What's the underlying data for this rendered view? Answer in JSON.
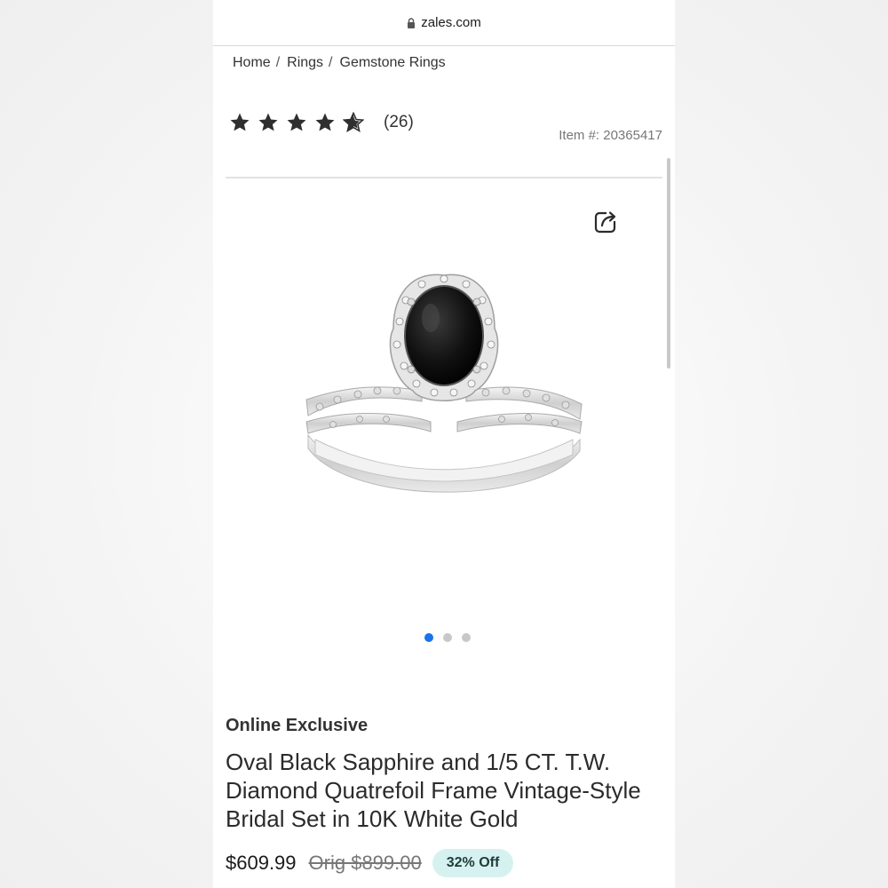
{
  "browser": {
    "domain": "zales.com"
  },
  "breadcrumb": {
    "items": [
      "Home",
      "Rings",
      "Gemstone Rings"
    ],
    "separator": "/"
  },
  "rating": {
    "stars": 4.5,
    "max": 5,
    "count": "(26)"
  },
  "item": {
    "number": "Item #: 20365417"
  },
  "gallery": {
    "slides": 3,
    "active_index": 0,
    "active_color": "#1a73e8"
  },
  "product": {
    "label": "Online Exclusive",
    "title": "Oval Black Sapphire and 1/5 CT. T.W. Diamond Quatrefoil Frame Vintage-Style Bridal Set in 10K White Gold",
    "price": "$609.99",
    "original_price": "Orig $899.00",
    "discount_badge": "32% Off",
    "badge_color": "#d6f2f0"
  }
}
